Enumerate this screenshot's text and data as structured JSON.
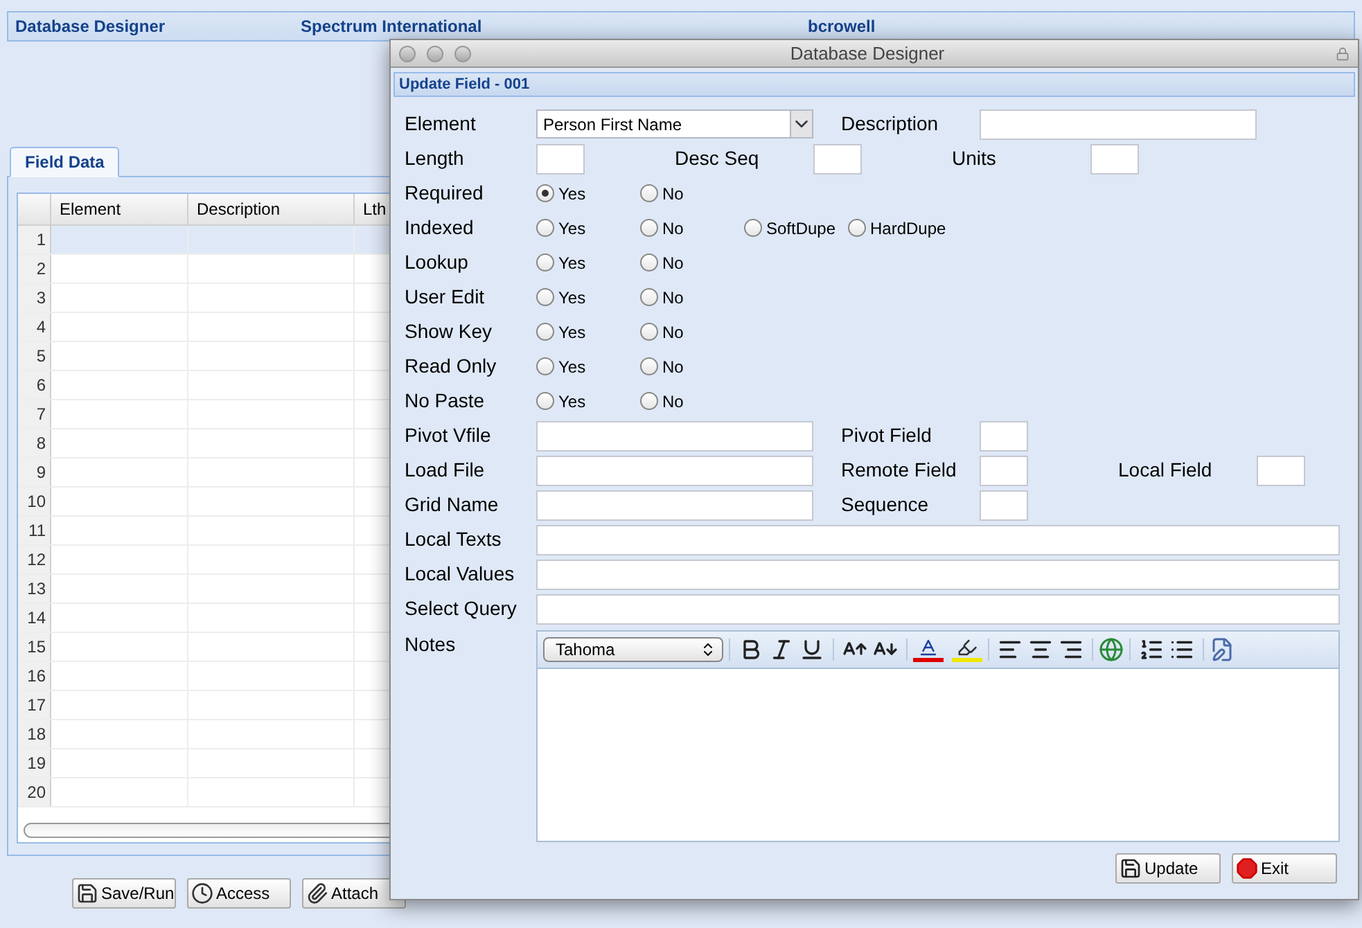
{
  "header": {
    "app": "Database Designer",
    "company": "Spectrum International",
    "user": "bcrowell"
  },
  "tabs": [
    {
      "label": "Field Data",
      "selected": true
    }
  ],
  "grid": {
    "columns": [
      "Element",
      "Description",
      "Lth"
    ],
    "rows": [
      {
        "num": "1",
        "selected": true
      },
      {
        "num": "2",
        "selected": false
      },
      {
        "num": "3",
        "selected": false
      },
      {
        "num": "4",
        "selected": false
      },
      {
        "num": "5",
        "selected": false
      },
      {
        "num": "6",
        "selected": false
      },
      {
        "num": "7",
        "selected": false
      },
      {
        "num": "8",
        "selected": false
      },
      {
        "num": "9",
        "selected": false
      },
      {
        "num": "10",
        "selected": false
      },
      {
        "num": "11",
        "selected": false
      },
      {
        "num": "12",
        "selected": false
      },
      {
        "num": "13",
        "selected": false
      },
      {
        "num": "14",
        "selected": false
      },
      {
        "num": "15",
        "selected": false
      },
      {
        "num": "16",
        "selected": false
      },
      {
        "num": "17",
        "selected": false
      },
      {
        "num": "18",
        "selected": false
      },
      {
        "num": "19",
        "selected": false
      },
      {
        "num": "20",
        "selected": false
      }
    ]
  },
  "buttons": [
    "Save/Run",
    "Access",
    "Attach"
  ],
  "dialog": {
    "title": "Database Designer",
    "section": "Update Field - 001",
    "rows": [
      {
        "kind": "inputs",
        "items": [
          {
            "label": "Element",
            "kind": "select",
            "value": "Person First Name"
          },
          {
            "label": "Description",
            "kind": "medium"
          }
        ]
      },
      {
        "kind": "inputs",
        "items": [
          {
            "label": "Length",
            "kind": "short"
          },
          {
            "label": "Desc Seq",
            "kind": "short"
          },
          {
            "label": "Units",
            "kind": "short"
          }
        ]
      },
      {
        "kind": "radio",
        "label": "Required",
        "options": [
          {
            "label": "Yes",
            "selected": true
          },
          {
            "label": "No",
            "selected": false
          }
        ]
      },
      {
        "kind": "radio",
        "label": "Indexed",
        "options": [
          {
            "label": "Yes",
            "selected": false
          },
          {
            "label": "No",
            "selected": false
          },
          {
            "label": "SoftDupe",
            "selected": false
          },
          {
            "label": "HardDupe",
            "selected": false
          }
        ]
      },
      {
        "kind": "radio",
        "label": "Lookup",
        "options": [
          {
            "label": "Yes",
            "selected": false
          },
          {
            "label": "No",
            "selected": false
          }
        ]
      },
      {
        "kind": "radio",
        "label": "User Edit",
        "options": [
          {
            "label": "Yes",
            "selected": false
          },
          {
            "label": "No",
            "selected": false
          }
        ]
      },
      {
        "kind": "radio",
        "label": "Show Key",
        "options": [
          {
            "label": "Yes",
            "selected": false
          },
          {
            "label": "No",
            "selected": false
          }
        ]
      },
      {
        "kind": "radio",
        "label": "Read Only",
        "options": [
          {
            "label": "Yes",
            "selected": false
          },
          {
            "label": "No",
            "selected": false
          }
        ]
      },
      {
        "kind": "radio",
        "label": "No Paste",
        "options": [
          {
            "label": "Yes",
            "selected": false
          },
          {
            "label": "No",
            "selected": false
          }
        ]
      },
      {
        "kind": "inputs",
        "items": [
          {
            "label": "Pivot Vfile",
            "kind": "medium"
          },
          {
            "label": "Pivot Field",
            "kind": "short"
          }
        ]
      },
      {
        "kind": "inputs",
        "items": [
          {
            "label": "Load File",
            "kind": "medium"
          },
          {
            "label": "Remote Field",
            "kind": "short"
          },
          {
            "label": "Local Field",
            "kind": "short"
          }
        ]
      },
      {
        "kind": "inputs",
        "items": [
          {
            "label": "Grid Name",
            "kind": "medium"
          },
          {
            "label": "Sequence",
            "kind": "short"
          }
        ]
      },
      {
        "kind": "inputs",
        "items": [
          {
            "label": "Local Texts",
            "kind": "full"
          }
        ]
      },
      {
        "kind": "inputs",
        "items": [
          {
            "label": "Local Values",
            "kind": "full"
          }
        ]
      },
      {
        "kind": "inputs",
        "items": [
          {
            "label": "Select Query",
            "kind": "full"
          }
        ]
      },
      {
        "kind": "editor",
        "label": "Notes",
        "font": "Tahoma"
      }
    ],
    "buttons": [
      "Update",
      "Exit"
    ]
  }
}
